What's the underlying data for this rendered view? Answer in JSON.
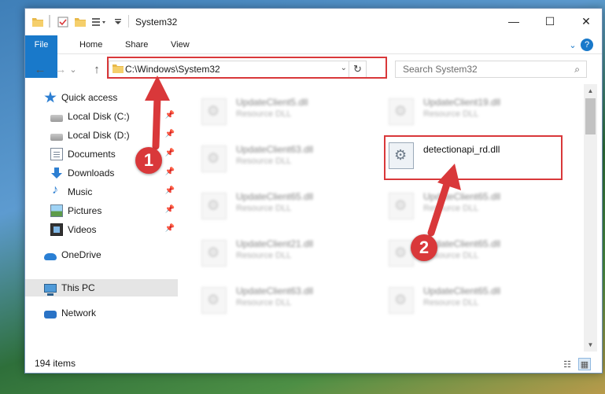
{
  "window": {
    "title": "System32",
    "controls": {
      "minimize": "—",
      "maximize": "☐",
      "close": "✕"
    }
  },
  "ribbon": {
    "tabs": [
      "File",
      "Home",
      "Share",
      "View"
    ],
    "expand_glyph": "⌄",
    "help_glyph": "?"
  },
  "navigation": {
    "back": "←",
    "forward": "→",
    "recent": "⌄",
    "up": "↑",
    "address_path": "C:\\Windows\\System32",
    "address_dropdown": "⌄",
    "refresh": "↻",
    "search_placeholder": "Search System32",
    "search_glyph": "⌕"
  },
  "sidebar": {
    "items": [
      {
        "label": "Quick access",
        "icon": "star-icon",
        "pinned": false
      },
      {
        "label": "Local Disk (C:)",
        "icon": "disk-icon",
        "pinned": true
      },
      {
        "label": "Local Disk (D:)",
        "icon": "disk-icon",
        "pinned": true
      },
      {
        "label": "Documents",
        "icon": "documents-icon",
        "pinned": true
      },
      {
        "label": "Downloads",
        "icon": "downloads-icon",
        "pinned": true
      },
      {
        "label": "Music",
        "icon": "music-icon",
        "pinned": true
      },
      {
        "label": "Pictures",
        "icon": "pictures-icon",
        "pinned": true
      },
      {
        "label": "Videos",
        "icon": "videos-icon",
        "pinned": true
      },
      {
        "label": "OneDrive",
        "icon": "cloud-icon",
        "pinned": false
      },
      {
        "label": "This PC",
        "icon": "computer-icon",
        "pinned": false,
        "selected": true
      },
      {
        "label": "Network",
        "icon": "network-icon",
        "pinned": false
      }
    ],
    "pin_glyph": "📌"
  },
  "files": {
    "left_column": [
      {
        "name": "UpdateClient5.dll",
        "type": "Resource DLL"
      },
      {
        "name": "UpdateClient63.dll",
        "type": "Resource DLL"
      },
      {
        "name": "UpdateClient65.dll",
        "type": "Resource DLL"
      },
      {
        "name": "UpdateClient21.dll",
        "type": "Resource DLL"
      },
      {
        "name": "UpdateClient63.dll",
        "type": "Resource DLL"
      }
    ],
    "right_column": [
      {
        "name": "UpdateClient19.dll",
        "type": "Resource DLL"
      },
      {
        "name": "detectionapi_rd.dll",
        "type": "",
        "highlighted": true
      },
      {
        "name": "UpdateClient65.dll",
        "type": "Resource DLL"
      },
      {
        "name": "UpdateClient65.dll",
        "type": "Resource DLL"
      },
      {
        "name": "UpdateClient65.dll",
        "type": "Resource DLL"
      }
    ]
  },
  "scrollbar": {
    "up": "▲",
    "down": "▼"
  },
  "status": {
    "item_count": "194 items",
    "view_details": "☷",
    "view_icons": "▦"
  },
  "callouts": [
    {
      "number": "1"
    },
    {
      "number": "2"
    }
  ],
  "colors": {
    "accent": "#1979ca",
    "callout_red": "#d9383a",
    "selection": "#e5e5e5"
  }
}
